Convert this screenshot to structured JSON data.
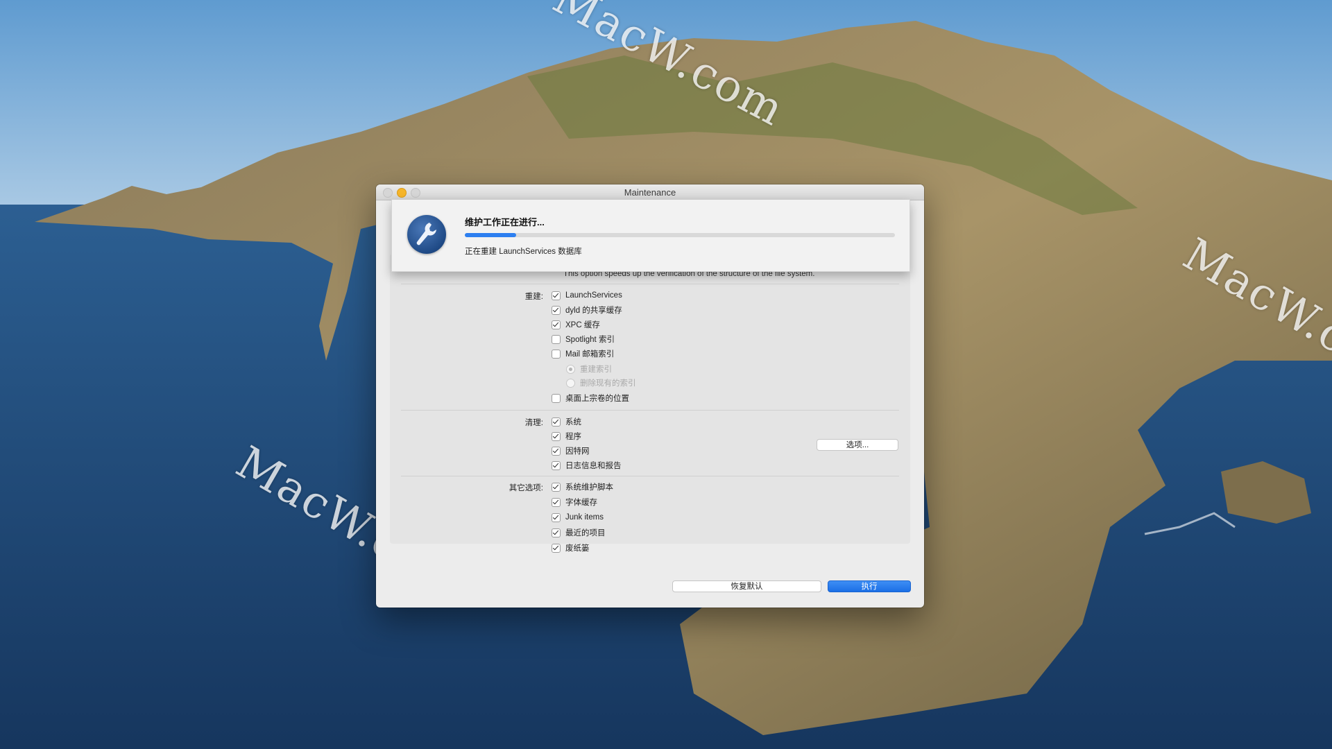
{
  "window": {
    "title": "Maintenance"
  },
  "progress": {
    "title": "维护工作正在进行...",
    "status": "正在重建 LaunchServices 数据库",
    "fraction": 0.12
  },
  "hint": "This option speeds up the verification of the structure of the file system.",
  "rebuild": {
    "label": "重建:",
    "items": [
      {
        "label": "LaunchServices",
        "checked": true
      },
      {
        "label": "dyld 的共享缓存",
        "checked": true
      },
      {
        "label": "XPC 缓存",
        "checked": true
      },
      {
        "label": "Spotlight 索引",
        "checked": false
      },
      {
        "label": "Mail 邮箱索引",
        "checked": false
      }
    ],
    "mail_options": [
      {
        "label": "重建索引",
        "selected": true
      },
      {
        "label": "删除现有的索引",
        "selected": false
      }
    ],
    "desktop": {
      "label": "桌面上宗卷的位置",
      "checked": false
    }
  },
  "cleanup": {
    "label": "清理:",
    "items": [
      {
        "label": "系统",
        "checked": true
      },
      {
        "label": "程序",
        "checked": true
      },
      {
        "label": "因特网",
        "checked": true
      },
      {
        "label": "日志信息和报告",
        "checked": true
      }
    ],
    "options_button": "选项..."
  },
  "other": {
    "label": "其它选项:",
    "items": [
      {
        "label": "系统维护脚本",
        "checked": true
      },
      {
        "label": "字体缓存",
        "checked": true
      },
      {
        "label": "Junk items",
        "checked": true
      },
      {
        "label": "最近的项目",
        "checked": true
      },
      {
        "label": "废纸篓",
        "checked": true
      }
    ]
  },
  "buttons": {
    "restore_defaults": "恢复默认",
    "execute": "执行"
  },
  "watermarks": [
    "MacW.com",
    "MacW.com",
    "MacW.com"
  ],
  "colors": {
    "accent": "#2d7ff0",
    "minimize": "#f5b52a"
  }
}
